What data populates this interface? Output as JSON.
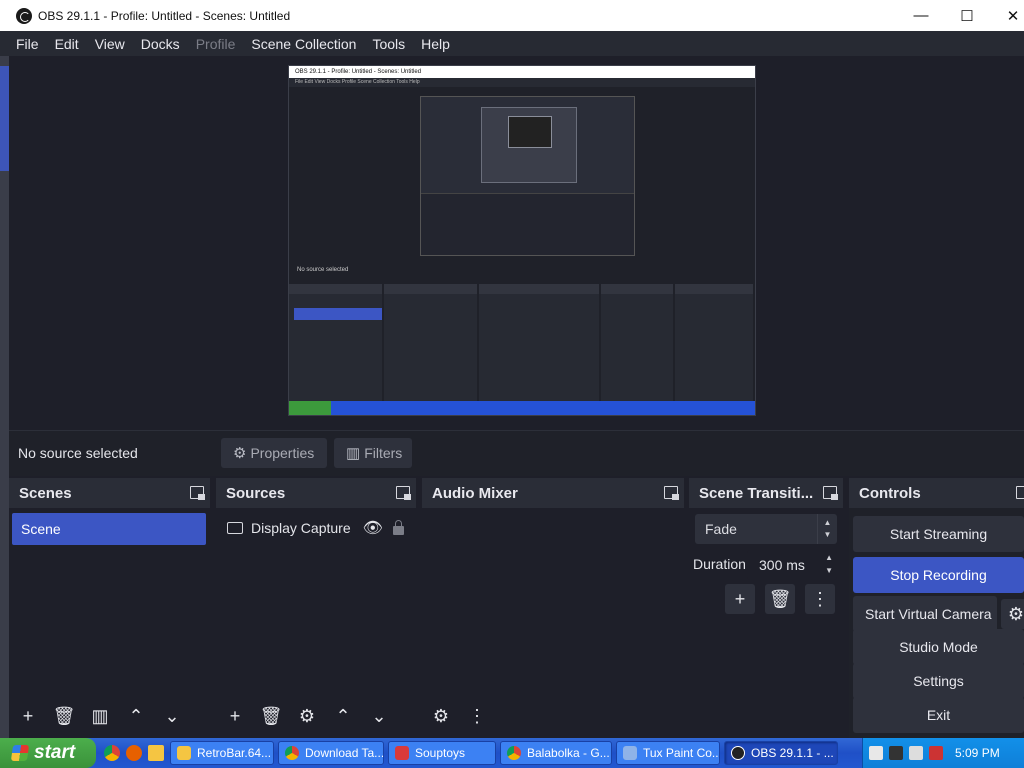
{
  "window": {
    "title": "OBS 29.1.1 - Profile: Untitled - Scenes: Untitled",
    "minimize_glyph": "—",
    "maximize_glyph": "☐",
    "close_glyph": "✕"
  },
  "menu": {
    "items": [
      "File",
      "Edit",
      "View",
      "Docks",
      "Profile",
      "Scene Collection",
      "Tools",
      "Help"
    ]
  },
  "status": {
    "no_source": "No source selected",
    "properties_label": "Properties",
    "filters_label": "Filters"
  },
  "docks": {
    "scenes": {
      "title": "Scenes",
      "items": [
        "Scene"
      ]
    },
    "sources": {
      "title": "Sources",
      "items": [
        {
          "name": "Display Capture"
        }
      ]
    },
    "mixer": {
      "title": "Audio Mixer"
    },
    "transitions": {
      "title": "Scene Transiti...",
      "selected": "Fade",
      "duration_label": "Duration",
      "duration_value": "300 ms"
    },
    "controls": {
      "title": "Controls",
      "start_streaming": "Start Streaming",
      "stop_recording": "Stop Recording",
      "start_virtual_camera": "Start Virtual Camera",
      "studio_mode": "Studio Mode",
      "settings": "Settings",
      "exit": "Exit"
    }
  },
  "taskbar": {
    "start_label": "start",
    "tasks": [
      "RetroBar.64...",
      "Download Ta...",
      "Souptoys",
      "Balabolka - G...",
      "Tux Paint Co...",
      "OBS 29.1.1 - ..."
    ],
    "clock": "5:09 PM"
  },
  "preview_text": {
    "title": "OBS 29.1.1 - Profile: Untitled - Scenes: Untitled",
    "menu": "File  Edit  View  Docks  Profile  Scene Collection  Tools  Help",
    "status": "No source selected"
  },
  "colors": {
    "accent": "#3c56c4",
    "background": "#1e1f29",
    "dock_header": "#2a2d37"
  }
}
